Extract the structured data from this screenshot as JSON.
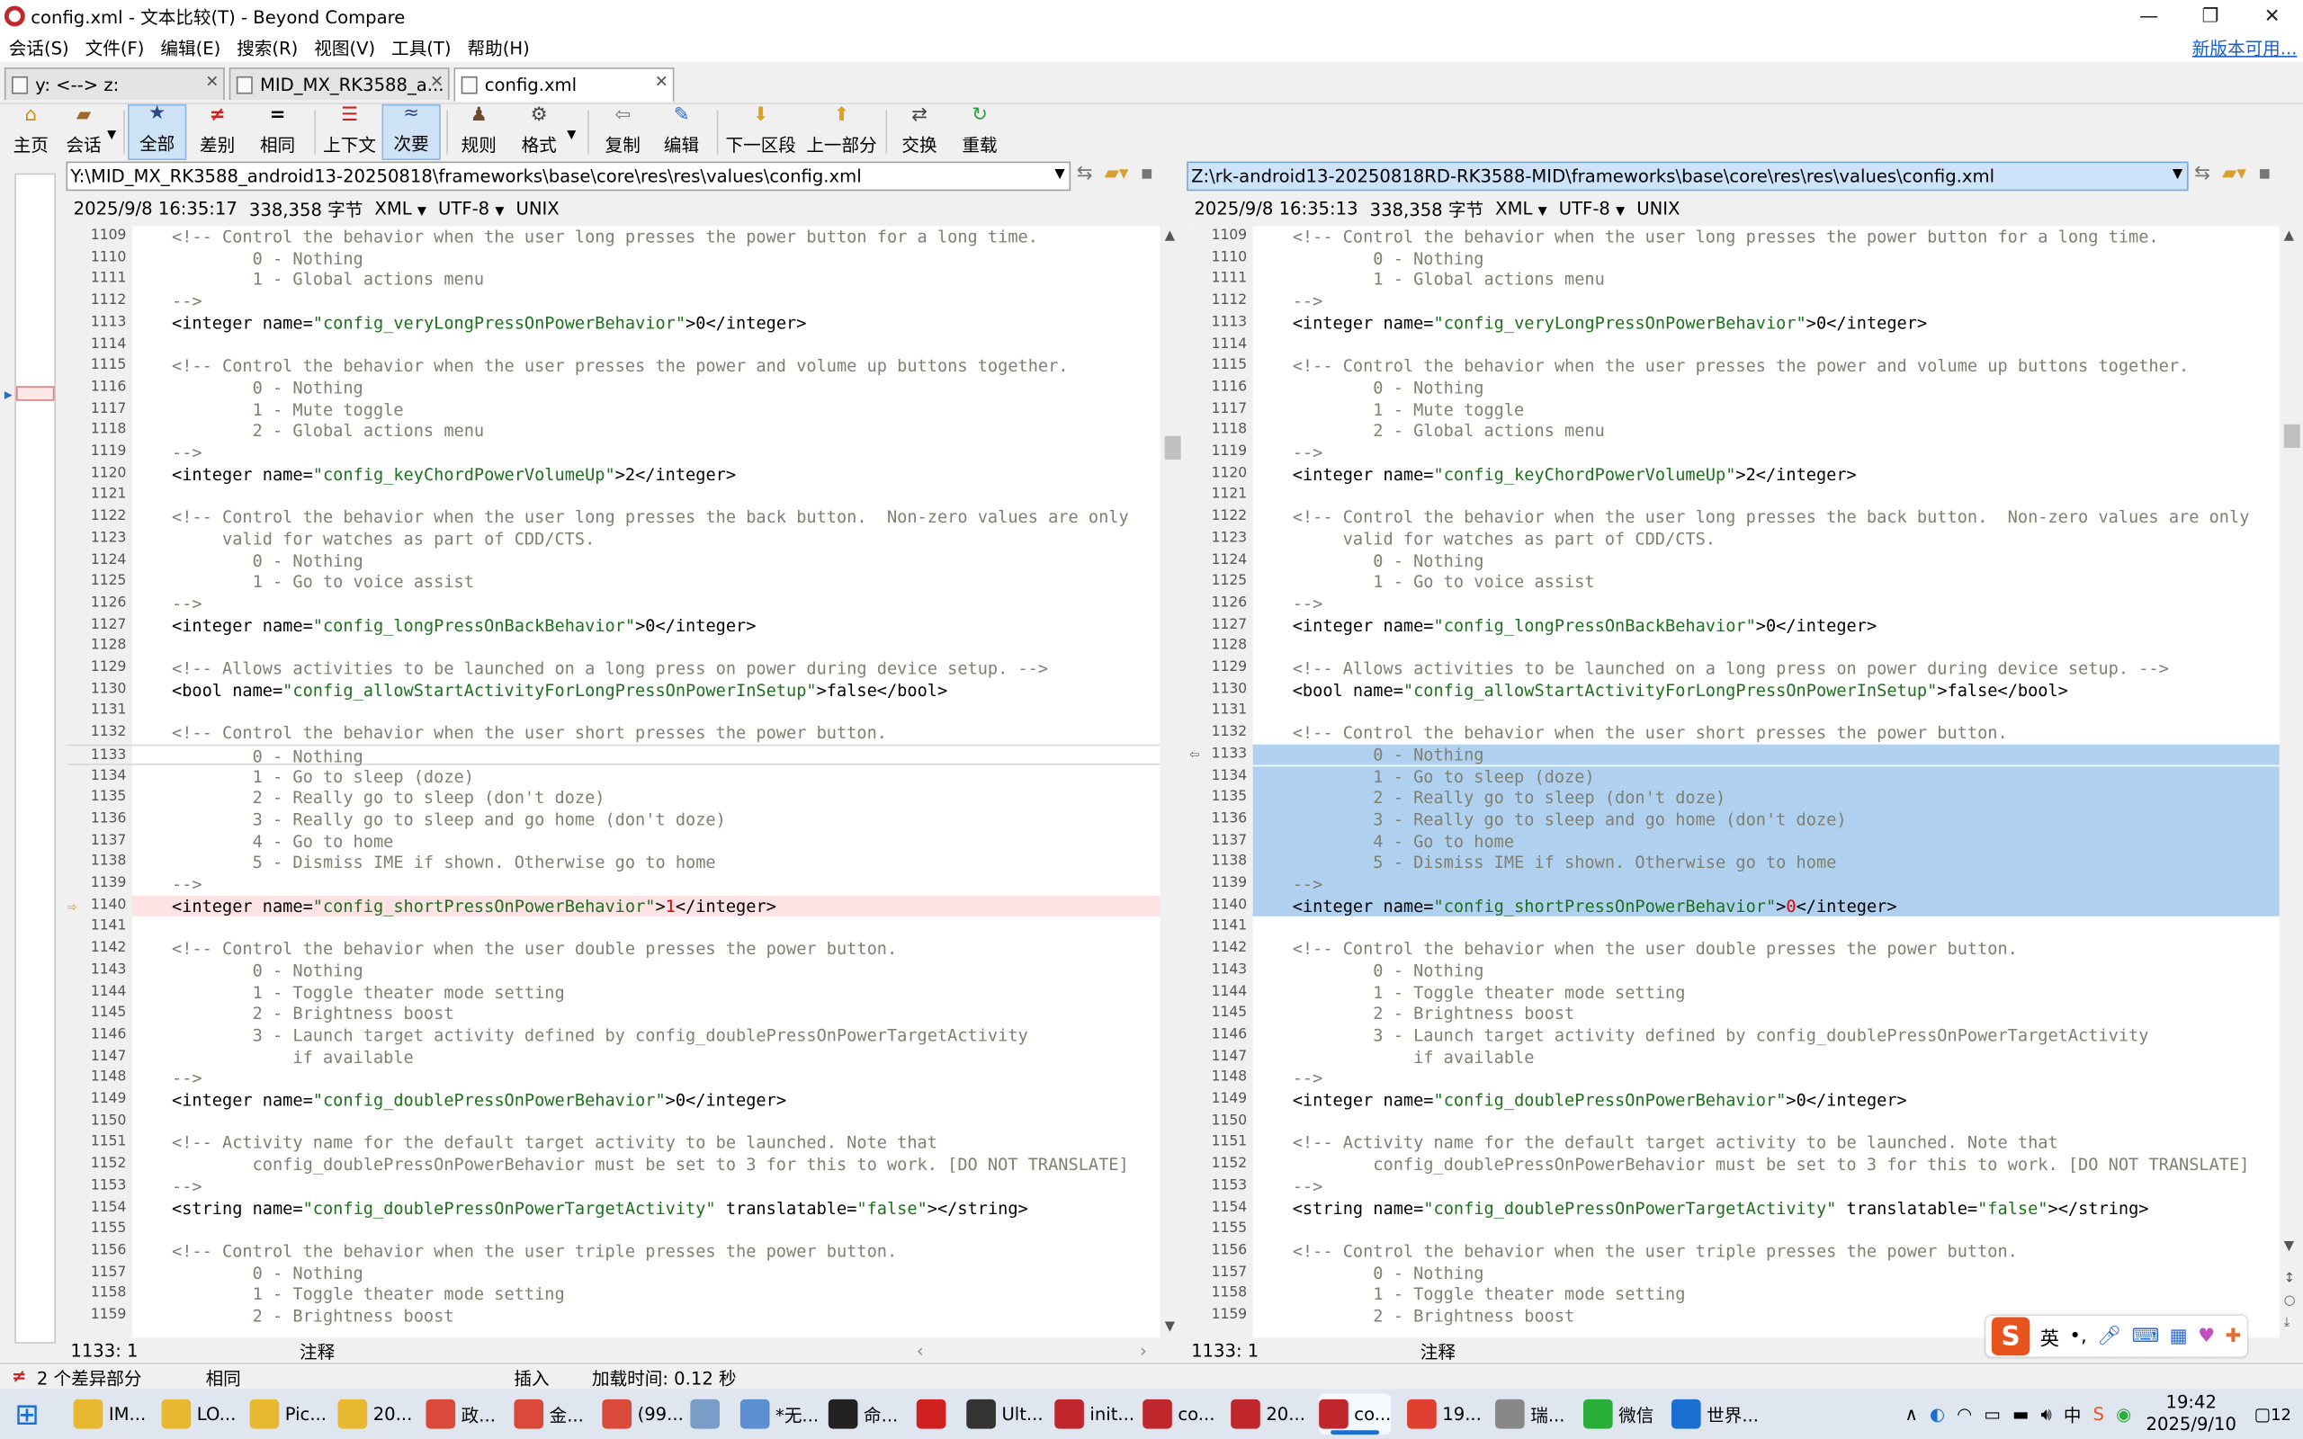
{
  "window": {
    "title": "config.xml - 文本比较(T) - Beyond Compare"
  },
  "window_controls": {
    "minimize": "—",
    "maximize": "❐",
    "close": "✕"
  },
  "menu": {
    "items": [
      "会话(S)",
      "文件(F)",
      "编辑(E)",
      "搜索(R)",
      "视图(V)",
      "工具(T)",
      "帮助(H)"
    ],
    "new_version": "新版本可用..."
  },
  "tabs": [
    {
      "label": "y: <--> z:"
    },
    {
      "label": "MID_MX_RK3588_a..."
    },
    {
      "label": "config.xml"
    }
  ],
  "toolbar": {
    "items": [
      {
        "label": "主页",
        "icon": "home-icon"
      },
      {
        "label": "会话",
        "icon": "briefcase-icon"
      },
      {
        "label": "全部",
        "icon": "star-icon"
      },
      {
        "label": "差别",
        "icon": "not-equal-icon"
      },
      {
        "label": "相同",
        "icon": "equal-icon"
      },
      {
        "label": "上下文",
        "icon": "context-icon"
      },
      {
        "label": "次要",
        "icon": "approx-icon"
      },
      {
        "label": "规则",
        "icon": "person-icon"
      },
      {
        "label": "格式",
        "icon": "format-icon"
      },
      {
        "label": "复制",
        "icon": "copy-left-icon"
      },
      {
        "label": "编辑",
        "icon": "edit-icon"
      },
      {
        "label": "下一区段",
        "icon": "arrow-down-icon"
      },
      {
        "label": "上一部分",
        "icon": "arrow-up-icon"
      },
      {
        "label": "交换",
        "icon": "swap-icon"
      },
      {
        "label": "重载",
        "icon": "reload-icon"
      }
    ]
  },
  "left": {
    "path": "Y:\\MID_MX_RK3588_android13-20250818\\frameworks\\base\\core\\res\\res\\values\\config.xml",
    "date": "2025/9/8 16:35:17",
    "size": "338,358 字节",
    "format": "XML",
    "encoding": "UTF-8",
    "eol": "UNIX",
    "cursor": "1133: 1",
    "mode": "注释",
    "changed_value": "1"
  },
  "right": {
    "path": "Z:\\rk-android13-20250818RD-RK3588-MID\\frameworks\\base\\core\\res\\res\\values\\config.xml",
    "date": "2025/9/8 16:35:13",
    "size": "338,358 字节",
    "format": "XML",
    "encoding": "UTF-8",
    "eol": "UNIX",
    "cursor": "1133: 1",
    "mode": "注释",
    "changed_value": "0"
  },
  "lines": [
    {
      "n": "1109",
      "t": "<!-- Control the behavior when the user long presses the power button for a long time."
    },
    {
      "n": "1110",
      "t": "        0 - Nothing"
    },
    {
      "n": "1111",
      "t": "        1 - Global actions menu"
    },
    {
      "n": "1112",
      "t": "-->"
    },
    {
      "n": "1113",
      "pre": "<integer name=",
      "s": "\"config_veryLongPressOnPowerBehavior\"",
      "post": ">0</integer>"
    },
    {
      "n": "1114",
      "t": ""
    },
    {
      "n": "1115",
      "t": "<!-- Control the behavior when the user presses the power and volume up buttons together."
    },
    {
      "n": "1116",
      "t": "        0 - Nothing"
    },
    {
      "n": "1117",
      "t": "        1 - Mute toggle"
    },
    {
      "n": "1118",
      "t": "        2 - Global actions menu"
    },
    {
      "n": "1119",
      "t": "-->"
    },
    {
      "n": "1120",
      "pre": "<integer name=",
      "s": "\"config_keyChordPowerVolumeUp\"",
      "post": ">2</integer>"
    },
    {
      "n": "1121",
      "t": ""
    },
    {
      "n": "1122",
      "t": "<!-- Control the behavior when the user long presses the back button.  Non-zero values are only"
    },
    {
      "n": "1123",
      "t": "     valid for watches as part of CDD/CTS."
    },
    {
      "n": "1124",
      "t": "        0 - Nothing"
    },
    {
      "n": "1125",
      "t": "        1 - Go to voice assist"
    },
    {
      "n": "1126",
      "t": "-->"
    },
    {
      "n": "1127",
      "pre": "<integer name=",
      "s": "\"config_longPressOnBackBehavior\"",
      "post": ">0</integer>"
    },
    {
      "n": "1128",
      "t": ""
    },
    {
      "n": "1129",
      "t": "<!-- Allows activities to be launched on a long press on power during device setup. -->"
    },
    {
      "n": "1130",
      "pre": "<bool name=",
      "s": "\"config_allowStartActivityForLongPressOnPowerInSetup\"",
      "post": ">false</bool>"
    },
    {
      "n": "1131",
      "t": ""
    },
    {
      "n": "1132",
      "t": "<!-- Control the behavior when the user short presses the power button."
    },
    {
      "n": "1133",
      "t": "        0 - Nothing",
      "diff": true
    },
    {
      "n": "1134",
      "t": "        1 - Go to sleep (doze)",
      "diff": true
    },
    {
      "n": "1135",
      "t": "        2 - Really go to sleep (don't doze)",
      "diff": true
    },
    {
      "n": "1136",
      "t": "        3 - Really go to sleep and go home (don't doze)",
      "diff": true
    },
    {
      "n": "1137",
      "t": "        4 - Go to home",
      "diff": true
    },
    {
      "n": "1138",
      "t": "        5 - Dismiss IME if shown. Otherwise go to home",
      "diff": true
    },
    {
      "n": "1139",
      "t": "-->",
      "diff": true
    },
    {
      "n": "1140",
      "pre": "<integer name=",
      "s": "\"config_shortPressOnPowerBehavior\"",
      "post": ">",
      "val": true,
      "post2": "</integer>",
      "diff": true,
      "changed": true
    },
    {
      "n": "1141",
      "t": ""
    },
    {
      "n": "1142",
      "t": "<!-- Control the behavior when the user double presses the power button."
    },
    {
      "n": "1143",
      "t": "        0 - Nothing"
    },
    {
      "n": "1144",
      "t": "        1 - Toggle theater mode setting"
    },
    {
      "n": "1145",
      "t": "        2 - Brightness boost"
    },
    {
      "n": "1146",
      "t": "        3 - Launch target activity defined by config_doublePressOnPowerTargetActivity"
    },
    {
      "n": "1147",
      "t": "            if available"
    },
    {
      "n": "1148",
      "t": "-->"
    },
    {
      "n": "1149",
      "pre": "<integer name=",
      "s": "\"config_doublePressOnPowerBehavior\"",
      "post": ">0</integer>"
    },
    {
      "n": "1150",
      "t": ""
    },
    {
      "n": "1151",
      "t": "<!-- Activity name for the default target activity to be launched. Note that"
    },
    {
      "n": "1152",
      "t": "        config_doublePressOnPowerBehavior must be set to 3 for this to work. [DO NOT TRANSLATE]"
    },
    {
      "n": "1153",
      "t": "-->"
    },
    {
      "n": "1154",
      "pre": "<string name=",
      "s": "\"config_doublePressOnPowerTargetActivity\"",
      "mid": " translatable=",
      "s2": "\"false\"",
      "post": "></string>"
    },
    {
      "n": "1155",
      "t": ""
    },
    {
      "n": "1156",
      "t": "<!-- Control the behavior when the user triple presses the power button."
    },
    {
      "n": "1157",
      "t": "        0 - Nothing"
    },
    {
      "n": "1158",
      "t": "        1 - Toggle theater mode setting"
    },
    {
      "n": "1159",
      "t": "        2 - Brightness boost"
    }
  ],
  "status": {
    "diff_count": "2 个差异部分",
    "same": "相同",
    "insert": "插入",
    "load_time": "加载时间: 0.12 秒"
  },
  "ime": {
    "logo": "S",
    "lang": "英"
  },
  "taskbar": {
    "items": [
      {
        "label": "IM...",
        "color": "#e8b830"
      },
      {
        "label": "LO...",
        "color": "#e8b830"
      },
      {
        "label": "Pic...",
        "color": "#e8b830"
      },
      {
        "label": "20...",
        "color": "#e8b830"
      },
      {
        "label": "政...",
        "color": "#d94a3a"
      },
      {
        "label": "金...",
        "color": "#d94a3a"
      },
      {
        "label": "(99...",
        "color": "#d94a3a"
      },
      {
        "label": "",
        "color": "#7a9cc8"
      },
      {
        "label": "*无...",
        "color": "#5b8fd0"
      },
      {
        "label": "命...",
        "color": "#222222"
      },
      {
        "label": "",
        "color": "#d02020"
      },
      {
        "label": "Ult...",
        "color": "#333333"
      },
      {
        "label": "init...",
        "color": "#c0272d"
      },
      {
        "label": "co...",
        "color": "#c0272d"
      },
      {
        "label": "20...",
        "color": "#c0272d"
      },
      {
        "label": "co...",
        "color": "#c0272d"
      },
      {
        "label": "19...",
        "color": "#e04030"
      },
      {
        "label": "瑞...",
        "color": "#888888"
      },
      {
        "label": "微信",
        "color": "#2aae3a"
      },
      {
        "label": "世界...",
        "color": "#1a6fd0"
      }
    ],
    "time": "19:42",
    "date": "2025/9/10",
    "notifications": "12"
  }
}
